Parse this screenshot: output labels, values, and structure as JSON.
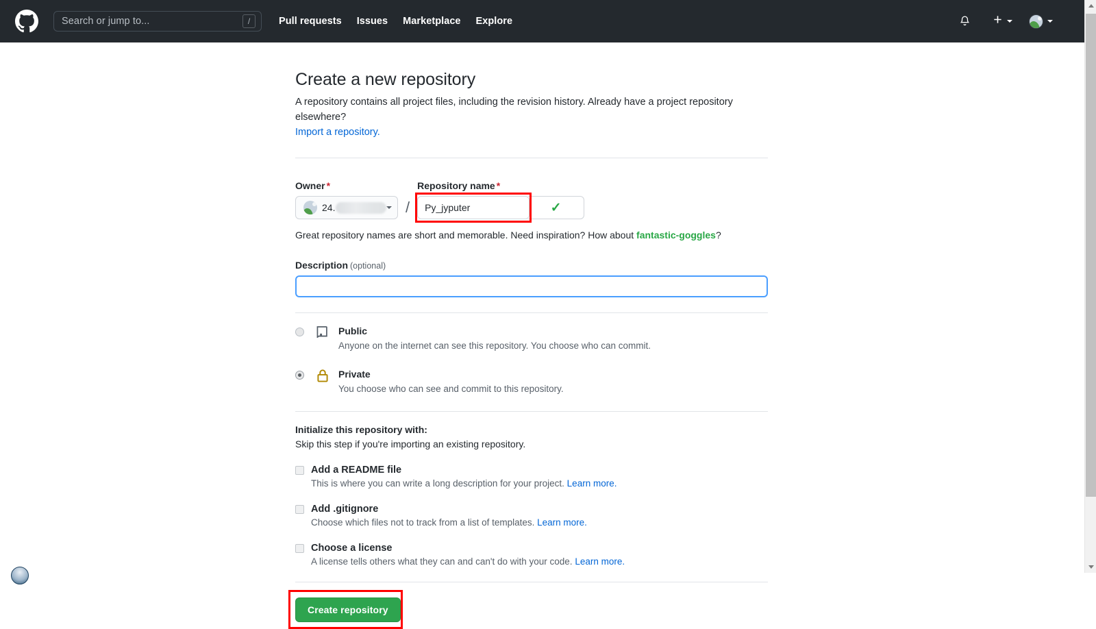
{
  "header": {
    "logo_icon": "github-mark-icon",
    "search": {
      "placeholder": "Search or jump to...",
      "shortcut_key": "/"
    },
    "nav": [
      {
        "label": "Pull requests"
      },
      {
        "label": "Issues"
      },
      {
        "label": "Marketplace"
      },
      {
        "label": "Explore"
      }
    ],
    "right": {
      "notifications_icon": "bell-icon",
      "create_new_icon": "plus-icon",
      "create_new_caret_icon": "chevron-down-icon",
      "avatar_icon": "user-avatar-icon",
      "avatar_caret_icon": "chevron-down-icon"
    },
    "background_color": "#24292e"
  },
  "main": {
    "title": "Create a new repository",
    "subtitle": "A repository contains all project files, including the revision history. Already have a project repository elsewhere?",
    "import_link": "Import a repository.",
    "owner": {
      "label": "Owner",
      "required_marker": "*",
      "value": "24.",
      "redacted": true,
      "caret_icon": "chevron-down-icon"
    },
    "separator": "/",
    "repo_name": {
      "label": "Repository name",
      "required_marker": "*",
      "value": "Py_jyputer",
      "valid_icon": "check-icon",
      "highlighted": true,
      "highlight_color": "#ff0000",
      "valid_color": "#28a745"
    },
    "name_hint": {
      "prefix": "Great repository names are short and memorable. Need inspiration? How about ",
      "suggestion": "fantastic-goggles",
      "suffix": "?"
    },
    "description": {
      "label": "Description",
      "optional_text": "(optional)",
      "value": "",
      "placeholder": "",
      "focused": true,
      "focus_color": "#4a9eff"
    },
    "visibility": [
      {
        "id": "public",
        "icon": "repo-book-icon",
        "title": "Public",
        "description": "Anyone on the internet can see this repository. You choose who can commit.",
        "selected": false
      },
      {
        "id": "private",
        "icon": "lock-icon",
        "title": "Private",
        "description": "You choose who can see and commit to this repository.",
        "selected": true
      }
    ],
    "initialize": {
      "title": "Initialize this repository with:",
      "subtitle": "Skip this step if you're importing an existing repository.",
      "options": [
        {
          "label": "Add a README file",
          "description": "This is where you can write a long description for your project. ",
          "link": "Learn more.",
          "checked": false
        },
        {
          "label": "Add .gitignore",
          "description": "Choose which files not to track from a list of templates. ",
          "link": "Learn more.",
          "checked": false
        },
        {
          "label": "Choose a license",
          "description": "A license tells others what they can and can't do with your code. ",
          "link": "Learn more.",
          "checked": false
        }
      ]
    },
    "submit": {
      "label": "Create repository",
      "color": "#2ea44f",
      "highlighted": true,
      "highlight_color": "#ff0000"
    }
  },
  "scrollbar": {
    "up_arrow_icon": "triangle-up-icon",
    "down_arrow_icon": "triangle-down-icon"
  }
}
